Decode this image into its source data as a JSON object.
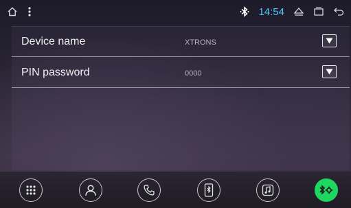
{
  "statusbar": {
    "time": "14:54",
    "icons": [
      "home-icon",
      "overflow-menu-icon",
      "bluetooth-icon",
      "eject-icon",
      "recent-apps-icon",
      "back-icon"
    ],
    "clock_color": "#4fc3f7"
  },
  "settings": {
    "rows": [
      {
        "label": "Device name",
        "value": "XTRONS"
      },
      {
        "label": "PIN password",
        "value": "0000"
      }
    ]
  },
  "dock": {
    "items": [
      {
        "icon": "keypad-icon",
        "active": false
      },
      {
        "icon": "contacts-icon",
        "active": false
      },
      {
        "icon": "phone-icon",
        "active": false
      },
      {
        "icon": "phone-bluetooth-icon",
        "active": false
      },
      {
        "icon": "music-icon",
        "active": false
      },
      {
        "icon": "bluetooth-settings-icon",
        "active": true
      }
    ],
    "active_color": "#1ed760"
  }
}
